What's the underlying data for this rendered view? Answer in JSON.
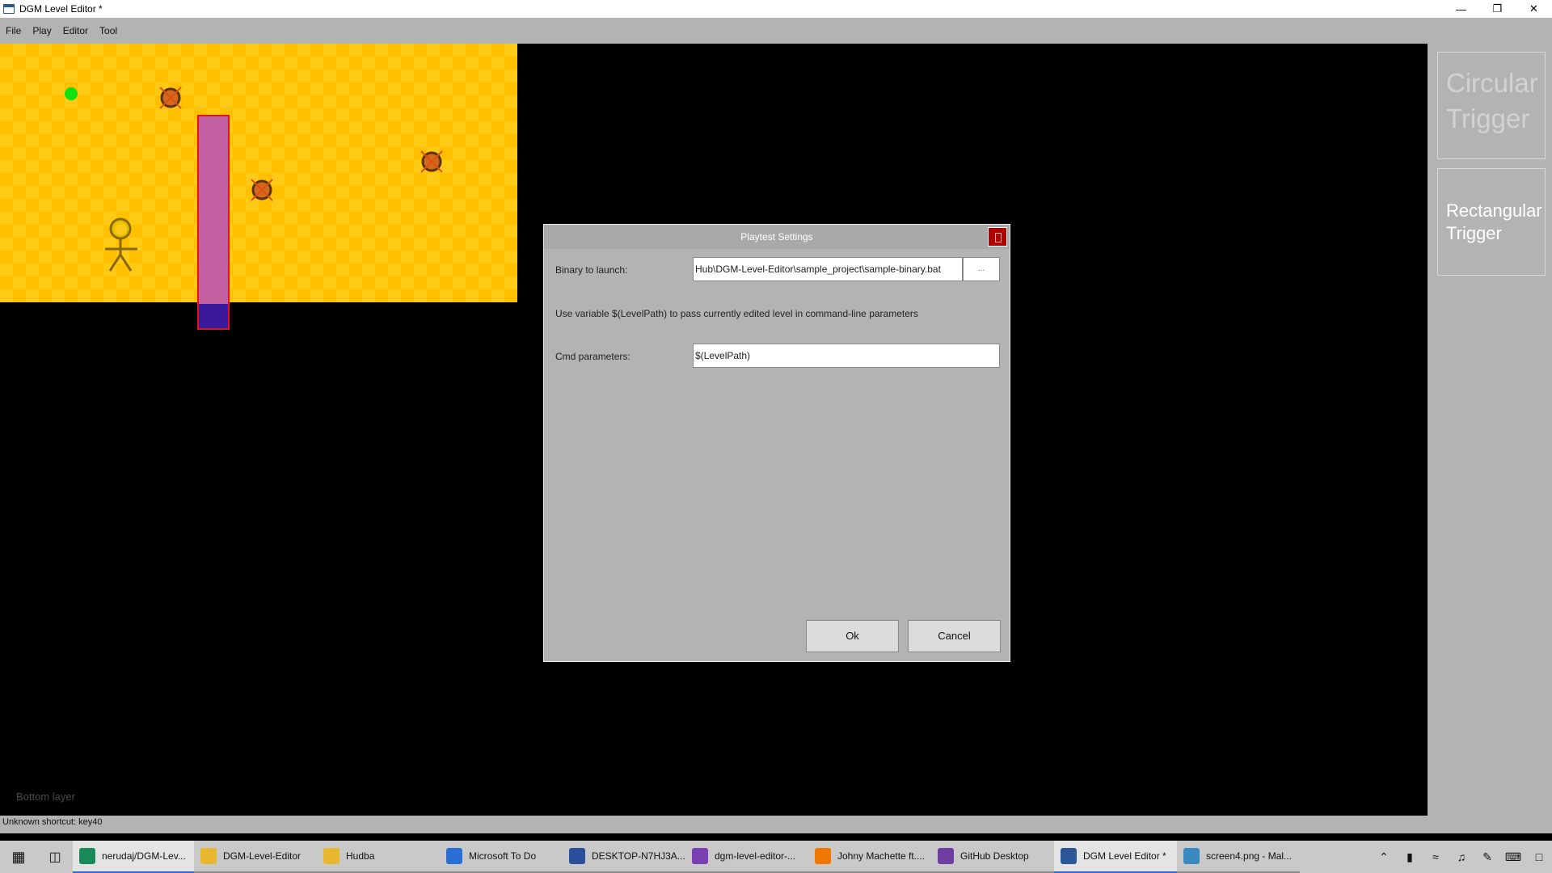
{
  "window": {
    "title": "DGM Level Editor *",
    "minimize_icon": "minimize-icon",
    "maximize_icon": "restore-icon",
    "close_icon": "close-icon"
  },
  "menu": {
    "items": [
      "File",
      "Play",
      "Editor",
      "Tool"
    ]
  },
  "canvas": {
    "level_background": "#ffc000",
    "layer_label": "Bottom layer"
  },
  "tools": {
    "circular": "Circular Trigger",
    "rectangular": "Rectangular Trigger"
  },
  "status": {
    "text": "Unknown shortcut: key40"
  },
  "dialog": {
    "title": "Playtest Settings",
    "binary_label": "Binary to launch:",
    "binary_value": "Hub\\DGM-Level-Editor\\sample_project\\sample-binary.bat",
    "browse_label": "...",
    "hint": "Use variable $(LevelPath) to pass currently edited level in command-line parameters",
    "cmd_label": "Cmd parameters:",
    "cmd_value": "$(LevelPath)",
    "ok_label": "Ok",
    "cancel_label": "Cancel"
  },
  "taskbar": {
    "items": [
      {
        "label": "nerudaj/DGM-Lev...",
        "icon": "edge-icon",
        "color": "#1a8a5a",
        "width": 150,
        "state": "active"
      },
      {
        "label": "DGM-Level-Editor",
        "icon": "folder-icon",
        "color": "#e8b830",
        "width": 152,
        "state": "open"
      },
      {
        "label": "Hudba",
        "icon": "folder-icon",
        "color": "#e8b830",
        "width": 152,
        "state": "open"
      },
      {
        "label": "Microsoft To Do",
        "icon": "todo-icon",
        "color": "#2b6fd6",
        "width": 152,
        "state": "open"
      },
      {
        "label": "DESKTOP-N7HJ3A...",
        "icon": "remote-desktop-icon",
        "color": "#2b4f9a",
        "width": 152,
        "state": "open"
      },
      {
        "label": "dgm-level-editor-...",
        "icon": "visual-studio-icon",
        "color": "#7a3fb0",
        "width": 152,
        "state": "open"
      },
      {
        "label": "Johny Machette ft....",
        "icon": "vlc-icon",
        "color": "#f07800",
        "width": 152,
        "state": "open"
      },
      {
        "label": "GitHub Desktop",
        "icon": "github-icon",
        "color": "#6e3fa0",
        "width": 152,
        "state": "open"
      },
      {
        "label": "DGM Level Editor *",
        "icon": "app-icon",
        "color": "#2b5797",
        "width": 152,
        "state": "active"
      },
      {
        "label": "screen4.png - Mal...",
        "icon": "paint-icon",
        "color": "#3a8ac0",
        "width": 152,
        "state": "open"
      }
    ],
    "tray": [
      "chevron-up-icon",
      "battery-icon",
      "wifi-icon",
      "volume-icon",
      "pen-icon",
      "keyboard-icon",
      "notification-icon"
    ]
  }
}
